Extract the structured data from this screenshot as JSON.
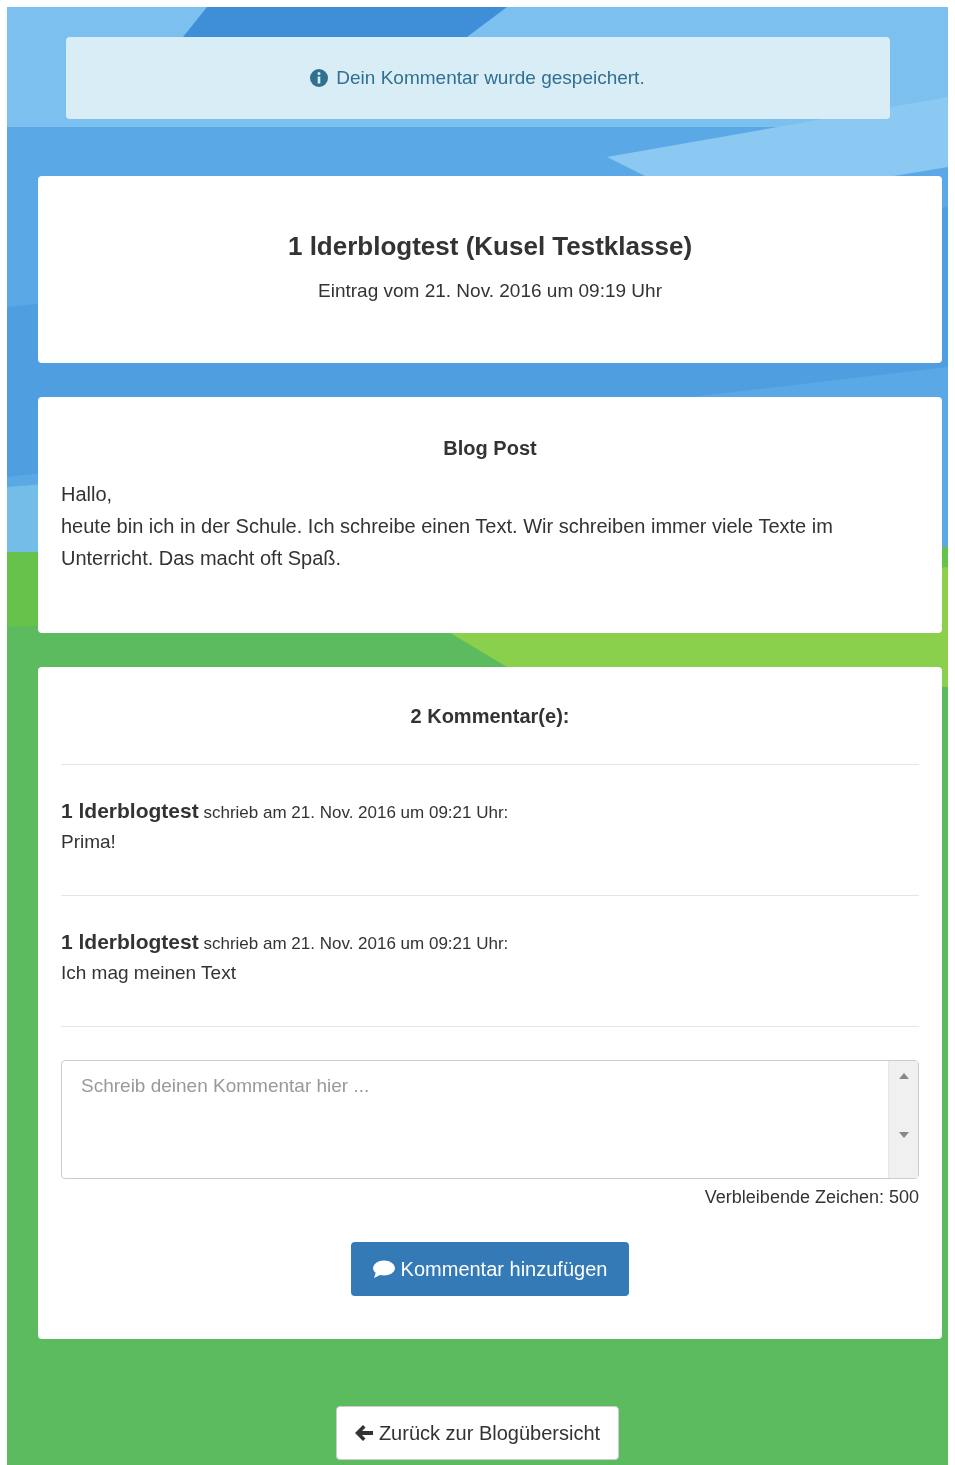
{
  "alert": {
    "text": "Dein Kommentar wurde gespeichert."
  },
  "entry": {
    "title": "1 lderblogtest (Kusel Testklasse)",
    "date": "Eintrag vom 21. Nov. 2016 um 09:19 Uhr"
  },
  "post": {
    "heading": "Blog Post",
    "paragraphs": [
      "Hallo,",
      "heute bin ich in der Schule. Ich schreibe einen Text. Wir schreiben immer viele Texte im Unterricht. Das macht oft Spaß."
    ]
  },
  "comments": {
    "heading": "2 Kommentar(e):",
    "items": [
      {
        "author": "1 lderblogtest",
        "meta": "schrieb am 21. Nov. 2016 um 09:21 Uhr:",
        "text": "Prima!"
      },
      {
        "author": "1 lderblogtest",
        "meta": "schrieb am 21. Nov. 2016 um 09:21 Uhr:",
        "text": "Ich mag meinen Text"
      }
    ]
  },
  "form": {
    "placeholder": "Schreib deinen Kommentar hier ...",
    "remaining": "Verbleibende Zeichen: 500",
    "submit": "Kommentar hinzufügen"
  },
  "back_button": "Zurück zur Blogübersicht"
}
